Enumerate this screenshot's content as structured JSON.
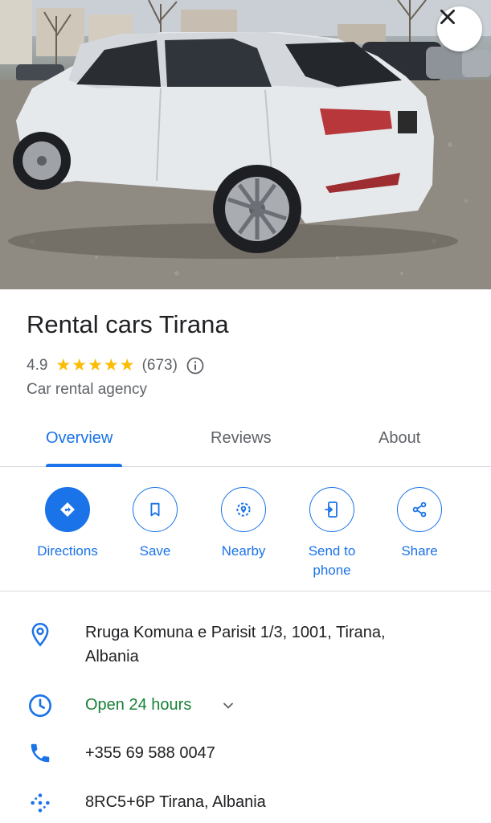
{
  "place": {
    "title": "Rental cars Tirana",
    "rating": "4.9",
    "stars": "★★★★★",
    "review_count": "(673)",
    "category": "Car rental agency"
  },
  "tabs": [
    {
      "label": "Overview",
      "active": true
    },
    {
      "label": "Reviews",
      "active": false
    },
    {
      "label": "About",
      "active": false
    }
  ],
  "actions": [
    {
      "label": "Directions",
      "icon": "directions-icon"
    },
    {
      "label": "Save",
      "icon": "bookmark-icon"
    },
    {
      "label": "Nearby",
      "icon": "nearby-icon"
    },
    {
      "label": "Send to phone",
      "icon": "send-to-phone-icon"
    },
    {
      "label": "Share",
      "icon": "share-icon"
    }
  ],
  "details": {
    "address": "Rruga Komuna e Parisit 1/3, 1001, Tirana, Albania",
    "hours": "Open 24 hours",
    "phone": "+355 69 588 0047",
    "plus_code": "8RC5+6P Tirana, Albania"
  },
  "colors": {
    "accent": "#1a73e8",
    "open_green": "#188038",
    "star": "#fbbc04",
    "text_secondary": "#5f6368"
  }
}
